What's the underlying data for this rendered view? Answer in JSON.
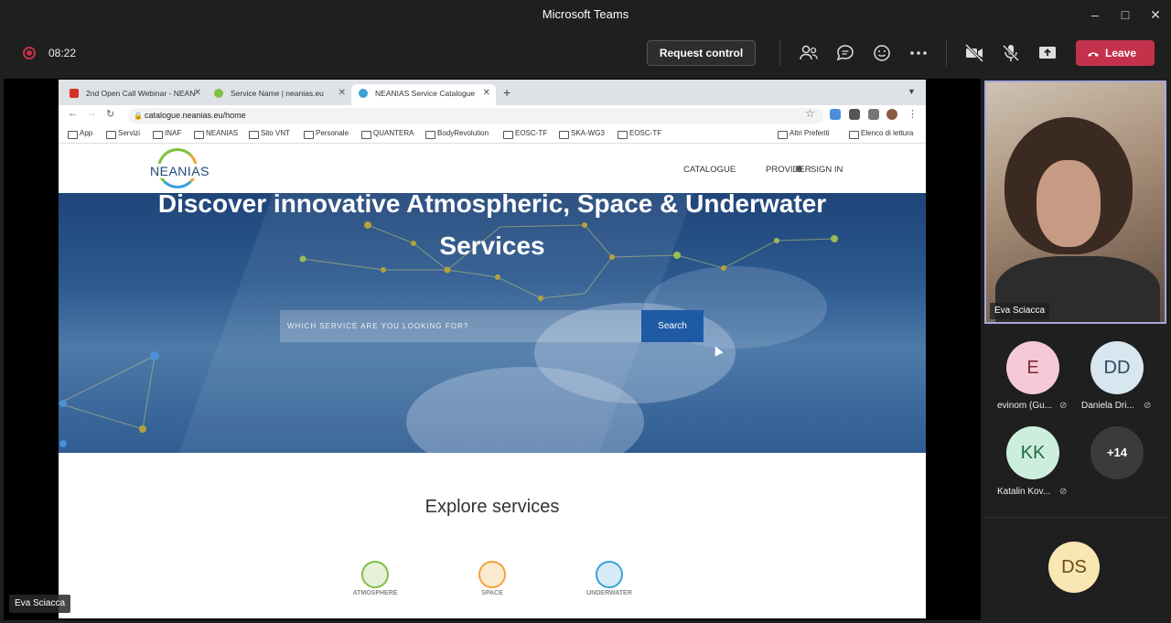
{
  "app": {
    "title": "Microsoft Teams"
  },
  "meeting": {
    "timer": "08:22",
    "request_control": "Request control",
    "leave": "Leave"
  },
  "browser": {
    "tabs": [
      {
        "label": "2nd Open Call Webinar - NEAN",
        "favicon_color": "#d93025"
      },
      {
        "label": "Service Name | neanias.eu",
        "favicon_color": "#7cc242"
      },
      {
        "label": "NEANIAS Service Catalogue",
        "favicon_color": "#3aa0d8"
      }
    ],
    "url": "catalogue.neanias.eu/home",
    "bookmarks": [
      "App",
      "Servizi",
      "INAF",
      "NEANIAS",
      "Sito VNT",
      "Personale",
      "QUANTERA",
      "BodyRevolution",
      "EOSC-TF",
      "SKA-WG3",
      "EOSC-TF"
    ],
    "bookmarks_right": [
      "Altri Preferiti",
      "Elenco di lettura"
    ]
  },
  "site": {
    "logo": "NEANIAS",
    "menu": [
      "CATALOGUE",
      "PROVIDER",
      "SIGN IN"
    ],
    "hero_line1": "Discover innovative Atmospheric, Space & Underwater",
    "hero_line2": "Services",
    "search_placeholder": "WHICH SERVICE ARE YOU LOOKING FOR?",
    "search_button": "Search",
    "explore_title": "Explore services",
    "categories": [
      "ATMOSPHERE",
      "SPACE",
      "UNDERWATER"
    ]
  },
  "presenter": "Eva Sciacca",
  "participants": {
    "video_name": "Eva Sciacca",
    "list": [
      {
        "initials": "E",
        "name": "evinom (Gu...",
        "bg": "#f5c9d6",
        "fg": "#7a2a3e"
      },
      {
        "initials": "DD",
        "name": "Daniela Dri...",
        "bg": "#d7e6ef",
        "fg": "#2d4a5c"
      },
      {
        "initials": "KK",
        "name": "Katalin Kov...",
        "bg": "#cdeedc",
        "fg": "#1d6a45"
      }
    ],
    "overflow": "+14",
    "bottom_initials": "DS"
  },
  "colors": {
    "leave": "#c4314b",
    "accent": "#a6a7dc",
    "search_btn": "#1f5aa5"
  }
}
